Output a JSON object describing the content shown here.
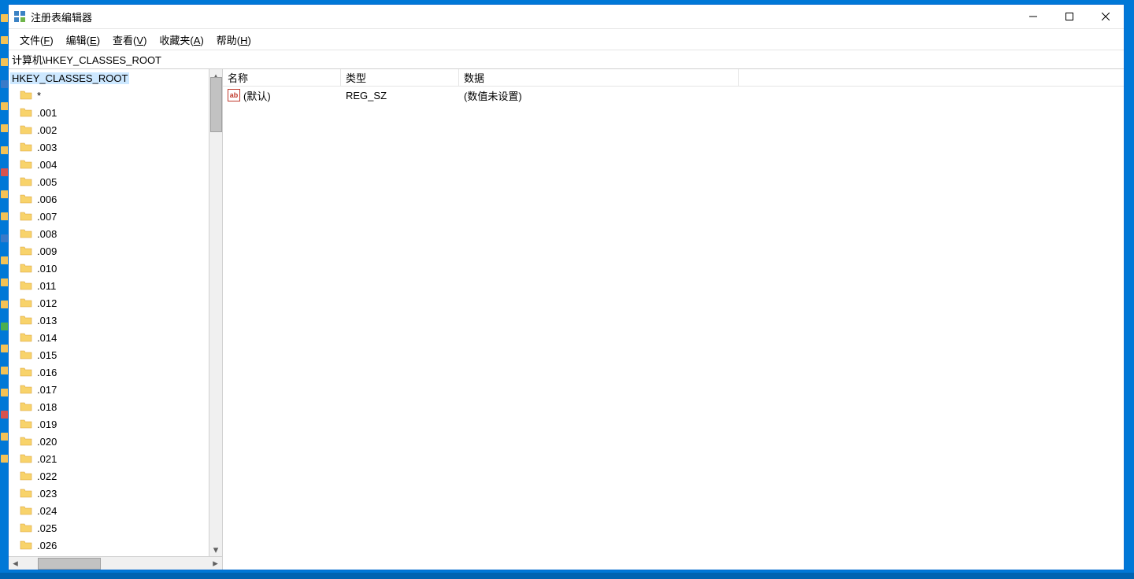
{
  "window": {
    "title": "注册表编辑器"
  },
  "menu": {
    "file": {
      "label": "文件",
      "hotkey": "F"
    },
    "edit": {
      "label": "编辑",
      "hotkey": "E"
    },
    "view": {
      "label": "查看",
      "hotkey": "V"
    },
    "fav": {
      "label": "收藏夹",
      "hotkey": "A"
    },
    "help": {
      "label": "帮助",
      "hotkey": "H"
    }
  },
  "address": "计算机\\HKEY_CLASSES_ROOT",
  "tree": {
    "root": "HKEY_CLASSES_ROOT",
    "children": [
      "*",
      ".001",
      ".002",
      ".003",
      ".004",
      ".005",
      ".006",
      ".007",
      ".008",
      ".009",
      ".010",
      ".011",
      ".012",
      ".013",
      ".014",
      ".015",
      ".016",
      ".017",
      ".018",
      ".019",
      ".020",
      ".021",
      ".022",
      ".023",
      ".024",
      ".025",
      ".026"
    ]
  },
  "columns": {
    "name": "名称",
    "type": "类型",
    "data": "数据"
  },
  "rows": [
    {
      "name": "(默认)",
      "type": "REG_SZ",
      "data": "(数值未设置)"
    }
  ]
}
